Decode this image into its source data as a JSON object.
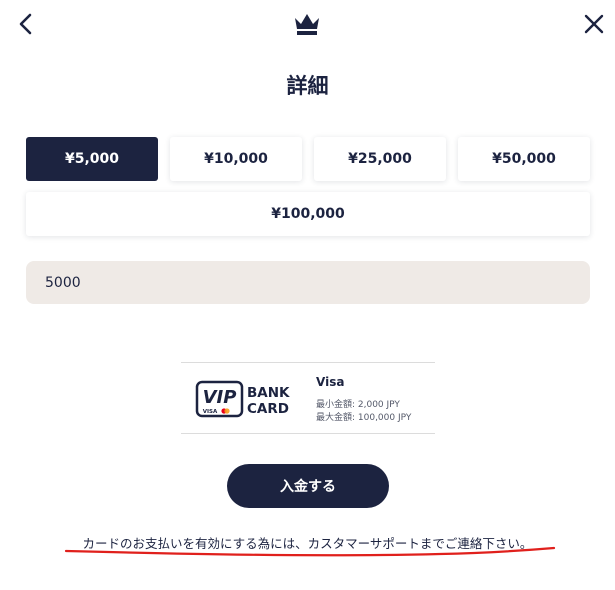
{
  "header": {
    "back_icon": "chevron-left-icon",
    "crown_icon": "crown-icon",
    "close_icon": "close-icon"
  },
  "title": "詳細",
  "amount_options": [
    {
      "label": "¥5,000",
      "selected": true
    },
    {
      "label": "¥10,000",
      "selected": false
    },
    {
      "label": "¥25,000",
      "selected": false
    },
    {
      "label": "¥50,000",
      "selected": false
    },
    {
      "label": "¥100,000",
      "selected": false
    }
  ],
  "amount_input": {
    "value": "5000"
  },
  "payment_method": {
    "logo": {
      "line1": "VIP",
      "sub": "VISA",
      "word1": "BANK",
      "word2": "CARD"
    },
    "name": "Visa",
    "min_amount": "最小金額: 2,000 JPY",
    "max_amount": "最大金額: 100,000 JPY"
  },
  "deposit_button": "入金する",
  "notice": "カードのお支払いを有効にする為には、カスタマーサポートまでご連絡下さい。",
  "colors": {
    "primary": "#1c2340",
    "input_bg": "#efeae6",
    "annotation_red": "#e0201c",
    "mastercard_red": "#eb001b",
    "mastercard_orange": "#f79e1b"
  }
}
